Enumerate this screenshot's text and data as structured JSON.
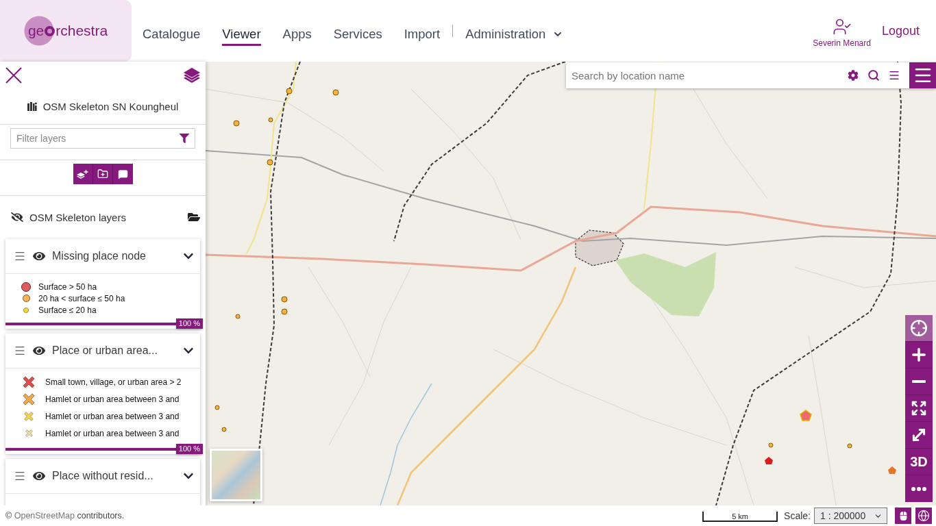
{
  "header": {
    "logo": {
      "parts": [
        "ge",
        "rchestra"
      ]
    },
    "nav": [
      {
        "label": "Catalogue",
        "kind": "link",
        "selected": false
      },
      {
        "label": "Viewer",
        "kind": "link",
        "selected": true
      },
      {
        "label": "Apps",
        "kind": "link",
        "selected": false
      },
      {
        "label": "Services",
        "kind": "link",
        "selected": false
      },
      {
        "label": "Import",
        "kind": "link",
        "selected": false
      },
      {
        "label": "Administration",
        "kind": "dropdown",
        "selected": false
      }
    ],
    "user": {
      "name": "Severin Menard"
    },
    "logout": "Logout"
  },
  "sidebar": {
    "title": "OSM Skeleton SN Koungheul",
    "filter": {
      "placeholder": "Filter layers"
    },
    "group": {
      "name": "OSM Skeleton layers",
      "visible": false
    },
    "layers": [
      {
        "name": "Missing place node",
        "visible": true,
        "expanded": true,
        "legend": [
          {
            "kind": "large_circle",
            "color": "#e05a5f",
            "label": "Surface > 50 ha"
          },
          {
            "kind": "medium_circle",
            "color": "#f7b456",
            "label": "20 ha < surface ≤ 50 ha"
          },
          {
            "kind": "small_circle",
            "color": "#f6d44c",
            "label": "Surface ≤ 20 ha"
          }
        ],
        "opacity": {
          "level": 1,
          "reading": "100 %"
        }
      },
      {
        "name": "Place or urban area...",
        "visible": true,
        "expanded": true,
        "legend": [
          {
            "kind": "large_cross",
            "color": "#e2494b",
            "label": "Small town, village, or urban area > 2"
          },
          {
            "kind": "large_cross",
            "color": "#f5a947",
            "label": "Hamlet or urban area between 3 and"
          },
          {
            "kind": "medium_cross",
            "color": "#f2d84a",
            "label": "Hamlet or urban area between 3 and"
          },
          {
            "kind": "small_cross",
            "color": "#efe2a0",
            "label": "Hamlet or urban area between 3 and"
          }
        ],
        "opacity": {
          "level": 1,
          "reading": "100 %"
        }
      },
      {
        "name": "Place without resid...",
        "visible": true,
        "expanded": true
      }
    ]
  },
  "map": {
    "search": {
      "placeholder": "Search by location name"
    },
    "tools": [
      {
        "kind": "locate",
        "active": true
      },
      {
        "kind": "zoom_in",
        "active": false
      },
      {
        "kind": "zoom_out",
        "active": false
      },
      {
        "kind": "extent",
        "active": false
      },
      {
        "kind": "fullscreen",
        "active": false
      },
      {
        "kind": "text",
        "label": "3D",
        "active": false
      },
      {
        "kind": "more",
        "active": false
      }
    ]
  },
  "footer": {
    "attribution": {
      "symbol": "©",
      "link": "OpenStreetMap",
      "text": "contributors."
    },
    "scale_bar": "5 km",
    "scale": {
      "label": "Scale:",
      "value": "1 : 200000"
    }
  }
}
